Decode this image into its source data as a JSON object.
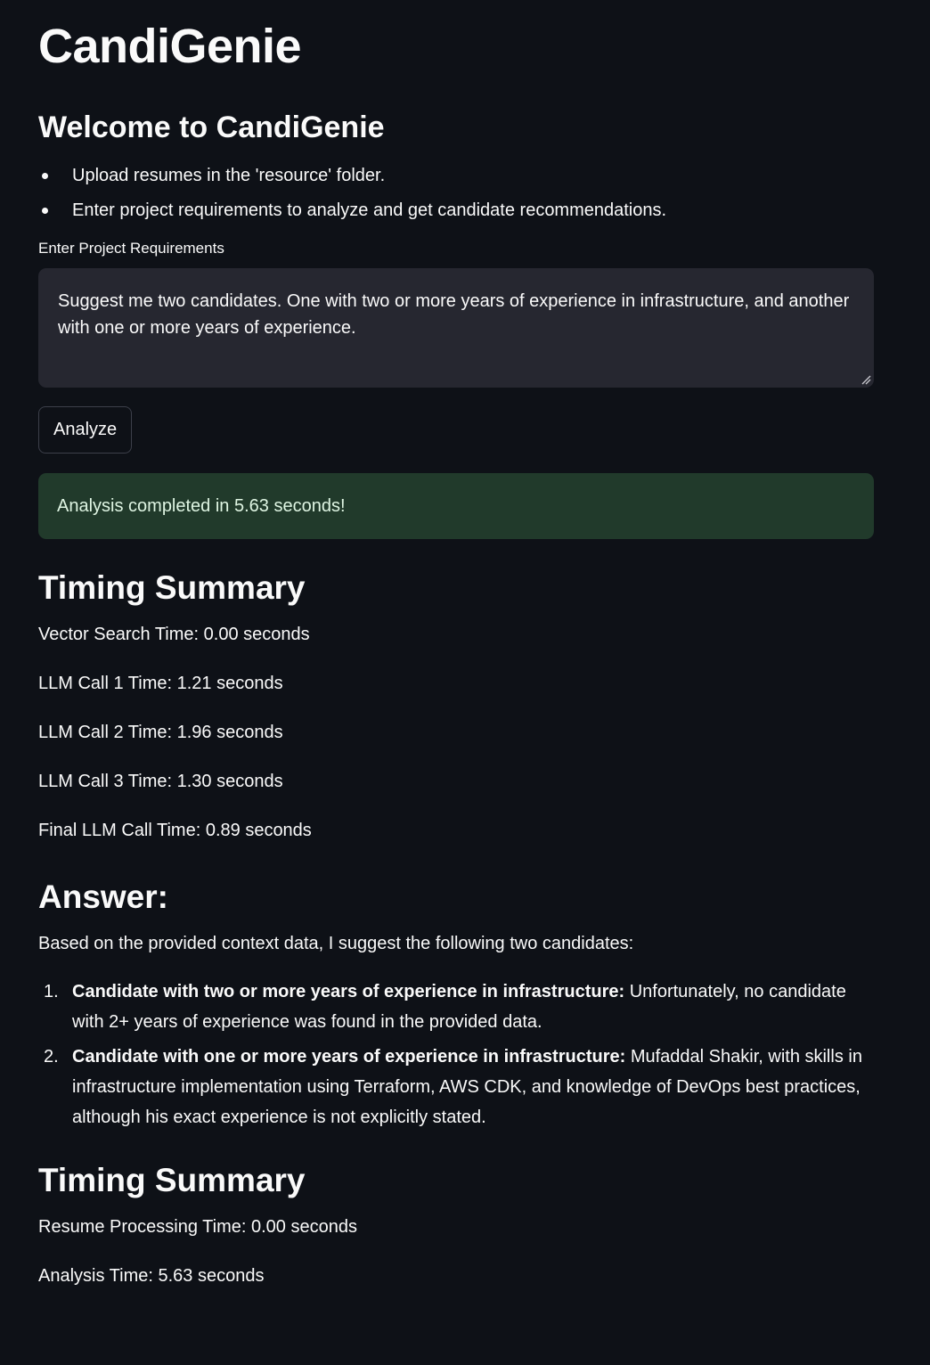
{
  "app": {
    "title": "CandiGenie",
    "welcome_heading": "Welcome to CandiGenie",
    "instructions": [
      "Upload resumes in the 'resource' folder.",
      "Enter project requirements to analyze and get candidate recommendations."
    ]
  },
  "requirements": {
    "label": "Enter Project Requirements",
    "value": "Suggest me two candidates. One with two or more years of experience in infrastructure, and another with one or more years of experience."
  },
  "analyze_button": {
    "label": "Analyze"
  },
  "status": {
    "message": "Analysis completed in 5.63 seconds!",
    "color": "#213a2b"
  },
  "timing_summary_1": {
    "heading": "Timing Summary",
    "lines": [
      "Vector Search Time: 0.00 seconds",
      "LLM Call 1 Time: 1.21 seconds",
      "LLM Call 2 Time: 1.96 seconds",
      "LLM Call 3 Time: 1.30 seconds",
      "Final LLM Call Time: 0.89 seconds"
    ]
  },
  "answer": {
    "heading": "Answer:",
    "intro": "Based on the provided context data, I suggest the following two candidates:",
    "items": [
      {
        "number": "1.",
        "title": "Candidate with two or more years of experience in infrastructure:",
        "text": " Unfortunately, no candidate with 2+ years of experience was found in the provided data."
      },
      {
        "number": "2.",
        "title": "Candidate with one or more years of experience in infrastructure:",
        "text": " Mufaddal Shakir, with skills in infrastructure implementation using Terraform, AWS CDK, and knowledge of DevOps best practices, although his exact experience is not explicitly stated."
      }
    ]
  },
  "timing_summary_2": {
    "heading": "Timing Summary",
    "lines": [
      "Resume Processing Time: 0.00 seconds",
      "Analysis Time: 5.63 seconds"
    ]
  },
  "theme": {
    "background": "#0e1117",
    "text": "#fafafa",
    "input_background": "#262730"
  }
}
